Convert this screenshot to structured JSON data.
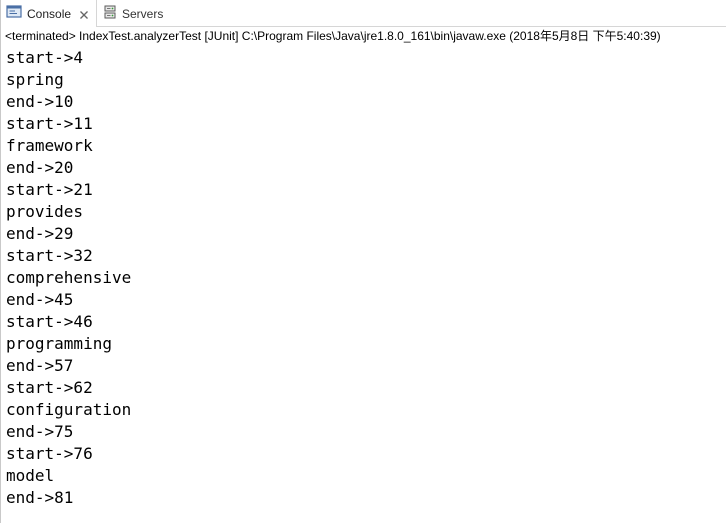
{
  "tabs": {
    "console": {
      "label": "Console",
      "icon": "console-icon",
      "close_icon": "close-icon"
    },
    "servers": {
      "label": "Servers",
      "icon": "servers-icon"
    }
  },
  "status": {
    "text": "<terminated> IndexTest.analyzerTest [JUnit] C:\\Program Files\\Java\\jre1.8.0_161\\bin\\javaw.exe (2018年5月8日 下午5:40:39)"
  },
  "console_output": [
    "start->4",
    "spring",
    "end->10",
    "start->11",
    "framework",
    "end->20",
    "start->21",
    "provides",
    "end->29",
    "start->32",
    "comprehensive",
    "end->45",
    "start->46",
    "programming",
    "end->57",
    "start->62",
    "configuration",
    "end->75",
    "start->76",
    "model",
    "end->81"
  ],
  "colors": {
    "console_icon_frame": "#4a6fa5",
    "console_icon_screen": "#dfe9f5",
    "close_icon": "#666666",
    "servers_icon": "#5a5a5a"
  }
}
